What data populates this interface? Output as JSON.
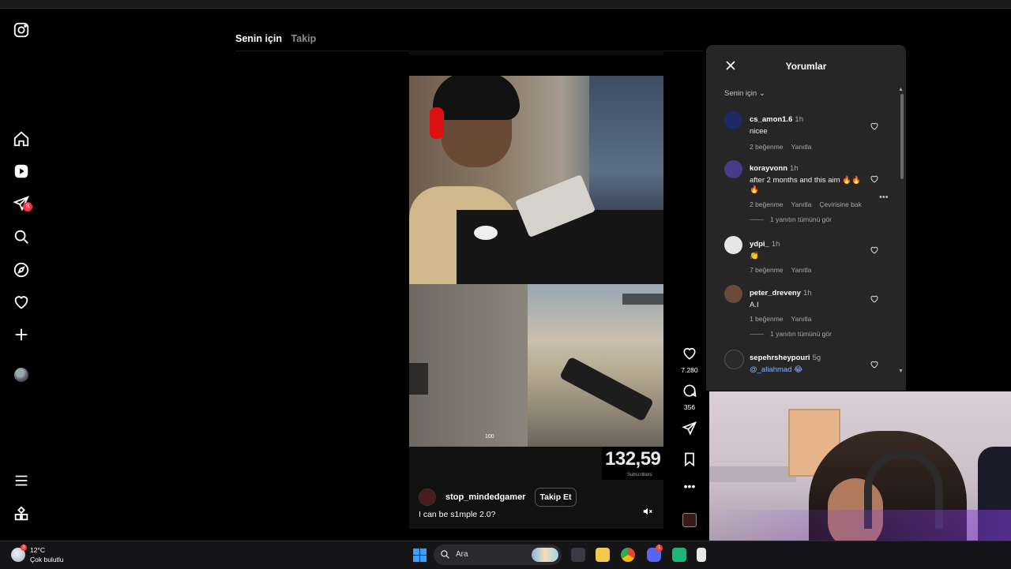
{
  "feed": {
    "tabs": [
      {
        "label": "Senin için",
        "active": true
      },
      {
        "label": "Takip",
        "active": false
      }
    ]
  },
  "nav": {
    "notification_count": "8",
    "items": [
      "instagram-logo-icon",
      "home-icon",
      "reels-icon",
      "direct-icon",
      "search-icon",
      "explore-icon",
      "heart-icon",
      "create-icon",
      "profile-avatar",
      "menu-icon",
      "more-apps-icon"
    ]
  },
  "video": {
    "subscriber_count": "132,59",
    "subscriber_label": "Subscribers",
    "hud_health": "100",
    "creator": "stop_mindedgamer",
    "follow_label": "Takip Et",
    "caption": "I can be s1mple 2.0?"
  },
  "actions": {
    "likes": "7.280",
    "comments": "356"
  },
  "comments_panel": {
    "title": "Yorumlar",
    "filter": "Senin için",
    "items": [
      {
        "user": "cs_amon1.6",
        "time": "1h",
        "text": "nicee",
        "likes": "2 beğenme",
        "reply": "Yanıtla",
        "avatar_color": "#1e2a66"
      },
      {
        "user": "korayvonn",
        "time": "1h",
        "text": "after 2 months and this aim 🔥🔥🔥",
        "likes": "2 beğenme",
        "reply": "Yanıtla",
        "translate": "Çevirisine bak",
        "replies": "1 yanıtın tümünü gör",
        "avatar_color": "#4a3a8a"
      },
      {
        "user": "ydpi_",
        "time": "1h",
        "text": "👏",
        "likes": "7 beğenme",
        "reply": "Yanıtla",
        "avatar_color": "#e6e6e6"
      },
      {
        "user": "peter_dreveny",
        "time": "1h",
        "text": "A.I",
        "likes": "1 beğenme",
        "reply": "Yanıtla",
        "replies": "1 yanıtın tümünü gör",
        "avatar_color": "#6a4a3a"
      },
      {
        "user": "sepehrsheypouri",
        "time": "5g",
        "text": "@_aliahmad 😂",
        "avatar_color": "#2a2a2a"
      }
    ]
  },
  "taskbar": {
    "temperature": "12°C",
    "condition": "Çok bulutlu",
    "weather_badge": "3",
    "search_placeholder": "Ara",
    "discord_badge": "1"
  },
  "colors": {
    "background": "#000000",
    "panel": "#262626",
    "notification": "#ff3040",
    "link": "#8ab4f8"
  }
}
